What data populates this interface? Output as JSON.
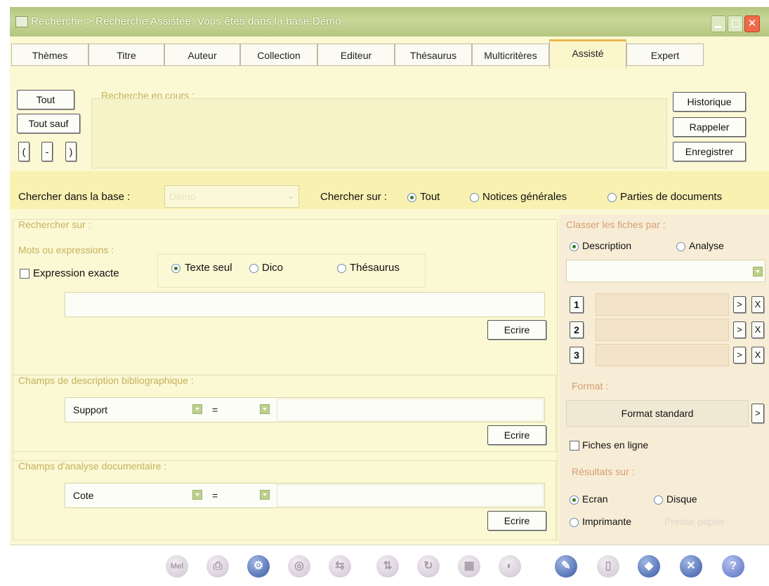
{
  "window": {
    "title": "Recherche > Recherche Assistée. Vous êtes dans la base Démo",
    "close_glyph": "✕"
  },
  "tabs": [
    "Thèmes",
    "Titre",
    "Auteur",
    "Collection",
    "Editeur",
    "Thésaurus",
    "Multicritères",
    "Assisté",
    "Expert"
  ],
  "active_tab": "Assisté",
  "current_search": {
    "label": "Recherche en cours :",
    "tout": "Tout",
    "tout_sauf": "Tout sauf",
    "open_paren": "(",
    "dash": "-",
    "close_paren": ")",
    "historique": "Historique",
    "rappeler": "Rappeler",
    "enregistrer": "Enregistrer"
  },
  "base": {
    "label": "Chercher dans la base :",
    "value": "Démo",
    "search_on_label": "Chercher sur :",
    "options": [
      "Tout",
      "Notices générales",
      "Parties de documents"
    ],
    "selected": "Tout"
  },
  "search_on": {
    "label": "Rechercher sur :",
    "words_label": "Mots ou expressions :",
    "exact_label": "Expression exacte",
    "exact_checked": false,
    "mode_options": [
      "Texte seul",
      "Dico",
      "Thésaurus"
    ],
    "mode_selected": "Texte seul",
    "words_value": "",
    "write": "Ecrire"
  },
  "biblio": {
    "label": "Champs de description bibliographique :",
    "field": "Support",
    "operator": "=",
    "value": "",
    "write": "Ecrire"
  },
  "analysis": {
    "label": "Champs d'analyse documentaire :",
    "field": "Cote",
    "operator": "=",
    "value": "",
    "write": "Ecrire"
  },
  "sort": {
    "label": "Classer les fiches par :",
    "options": [
      "Description",
      "Analyse"
    ],
    "selected": "Description",
    "select_value": "",
    "rows": [
      {
        "num": "1",
        "value": "",
        "go": ">",
        "clear": "X"
      },
      {
        "num": "2",
        "value": "",
        "go": ">",
        "clear": "X"
      },
      {
        "num": "3",
        "value": "",
        "go": ">",
        "clear": "X"
      }
    ]
  },
  "format": {
    "label": "Format :",
    "value": "Format standard",
    "go": ">"
  },
  "fiches_en_ligne": {
    "label": "Fiches en ligne",
    "checked": false
  },
  "results": {
    "label": "Résultats sur :",
    "options": [
      "Ecran",
      "Disque",
      "Imprimante",
      "Presse papier"
    ],
    "selected": "Ecran"
  },
  "toolbar_icons": [
    {
      "name": "mail-icon",
      "glyph": "Mel",
      "enabled": false
    },
    {
      "name": "print-icon",
      "glyph": "⎙",
      "enabled": false
    },
    {
      "name": "settings-icon",
      "glyph": "⚙",
      "enabled": true
    },
    {
      "name": "disk-icon",
      "glyph": "◎",
      "enabled": false
    },
    {
      "name": "export-icon",
      "glyph": "⇆",
      "enabled": false
    },
    {
      "name": "sort-icon",
      "glyph": "⇅",
      "enabled": false
    },
    {
      "name": "refresh-icon",
      "glyph": "↻",
      "enabled": false
    },
    {
      "name": "grid-icon",
      "glyph": "▦",
      "enabled": false
    },
    {
      "name": "reset-icon",
      "glyph": "◐",
      "enabled": false
    },
    {
      "name": "search-icon",
      "glyph": "✎",
      "enabled": true
    },
    {
      "name": "delete-icon",
      "glyph": "▯",
      "enabled": false
    },
    {
      "name": "validate-icon",
      "glyph": "◆",
      "enabled": true
    },
    {
      "name": "close-icon",
      "glyph": "✕",
      "enabled": true
    },
    {
      "name": "help-icon",
      "glyph": "?",
      "enabled": true
    }
  ],
  "colors": {
    "panel": "#fbf8d4",
    "title_bar": "#b8c98a",
    "group_label": "#c6b15c",
    "accent_tab": "#e9b84a"
  }
}
